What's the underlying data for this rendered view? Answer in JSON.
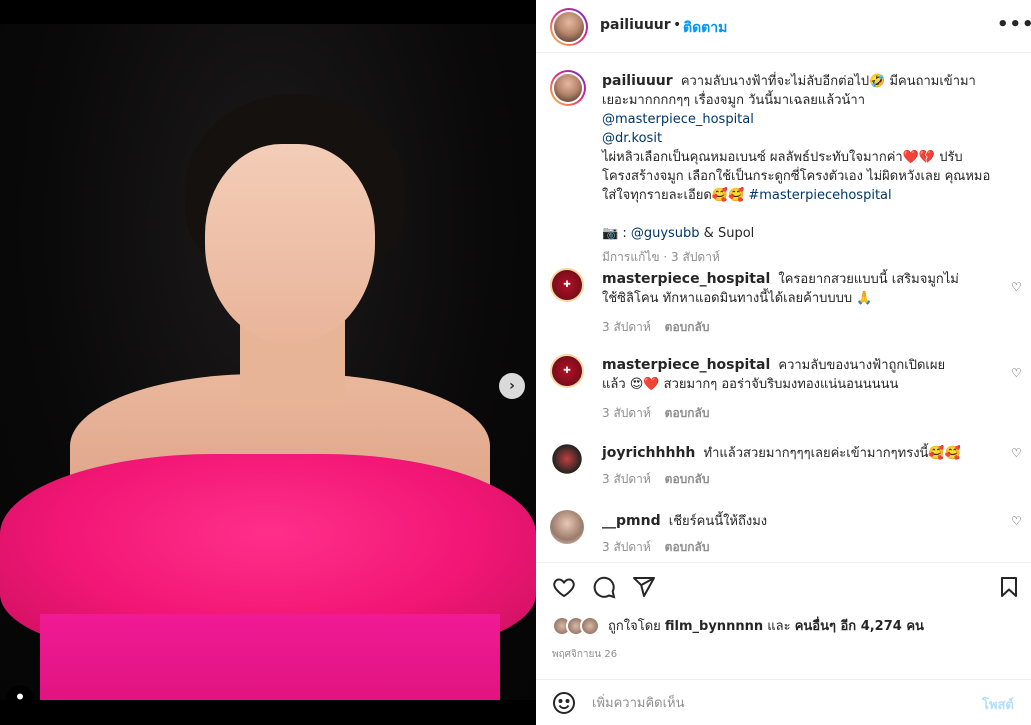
{
  "header": {
    "username": "pailiuuur",
    "separator": "•",
    "follow_label": "ติดตาม",
    "more_label": "•••"
  },
  "caption": {
    "username": "pailiuuur",
    "line1": "ความลับนางฟ้าที่จะไม่ลับอีกต่อไป🤣 มีคนถามเข้ามาเยอะมากกกกๆๆ เรื่องจมูก วันนี้มาเฉลยแล้วน้าา",
    "mention1": "@masterpiece_hospital",
    "mention2": "@dr.kosit",
    "line2": "ไผ่หลิวเลือกเป็นคุณหมอเบนซ์ ผลลัพธ์ประทับใจมากค่า❤️💔 ปรับโครงสร้างจมูก เลือกใช้เป็นกระดูกซี่โครงตัวเอง ไม่ผิดหวังเลย คุณหมอใส่ใจทุกรายละเอียด🥰🥰",
    "hashtag": "#masterpiecehospital",
    "credit_prefix": "📷 : ",
    "credit_mention": "@guysubb",
    "credit_suffix": " & Supol",
    "meta": "มีการแก้ไข · 3 สัปดาห์"
  },
  "comments": [
    {
      "username": "masterpiece_hospital",
      "text": "ใครอยากสวยแบบนี้ เสริมจมูกไม่ใช้ซิลิโคน ทักหาแอดมินทางนี้ได้เลยค้าบบบบ 🙏",
      "time": "3 สัปดาห์",
      "reply": "ตอบกลับ"
    },
    {
      "username": "masterpiece_hospital",
      "text": "ความลับของนางฟ้าถูกเปิดเผยแล้ว 😍❤️ สวยมากๆ ออร่าจับริบมงทองแน่นอนนนนน",
      "time": "3 สัปดาห์",
      "reply": "ตอบกลับ"
    },
    {
      "username": "joyrichhhhh",
      "text": "ทำแล้วสวยมากๆๆๆเลยค่ะเข้ามากๆทรงนี้🥰🥰",
      "time": "3 สัปดาห์",
      "reply": "ตอบกลับ"
    },
    {
      "username": "__pmnd",
      "text": "เชียร์คนนี้ให้ถึงมง",
      "time": "3 สัปดาห์",
      "reply": "ตอบกลับ"
    }
  ],
  "likes": {
    "prefix": "ถูกใจโดย",
    "user": "film_bynnnnn",
    "middle": "และ",
    "others": "คนอื่นๆ อีก 4,274 คน"
  },
  "date": "พฤศจิกายน 26",
  "add_comment": {
    "placeholder": "เพิ่มความคิดเห็น",
    "post_label": "โพสต์"
  },
  "colors": {
    "accent": "#0095f6",
    "link": "#00376b",
    "muted": "#8e8e8e",
    "post_disabled": "#b2dffc"
  }
}
